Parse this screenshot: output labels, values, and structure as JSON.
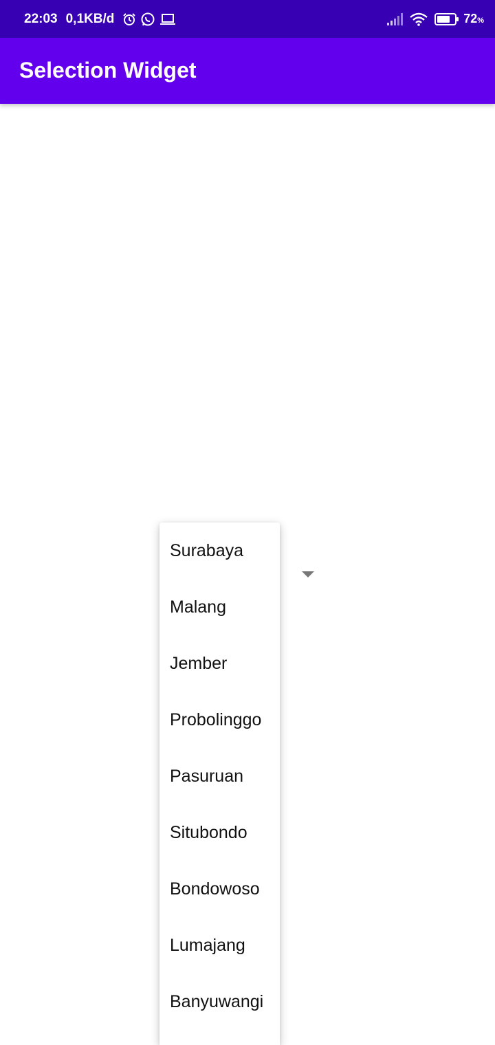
{
  "status_bar": {
    "time": "22:03",
    "net_speed": "0,1KB/d",
    "battery_percent": "72",
    "battery_symbol": "%",
    "icons": [
      "alarm-icon",
      "whatsapp-icon",
      "laptop-icon",
      "signal-icon",
      "wifi-icon",
      "battery-icon"
    ]
  },
  "app_bar": {
    "title": "Selection Widget",
    "background": "#6200EE"
  },
  "status_bar_color": "#3700B3",
  "spinner": {
    "options": [
      "Surabaya",
      "Malang",
      "Jember",
      "Probolinggo",
      "Pasuruan",
      "Situbondo",
      "Bondowoso",
      "Lumajang",
      "Banyuwangi"
    ]
  }
}
